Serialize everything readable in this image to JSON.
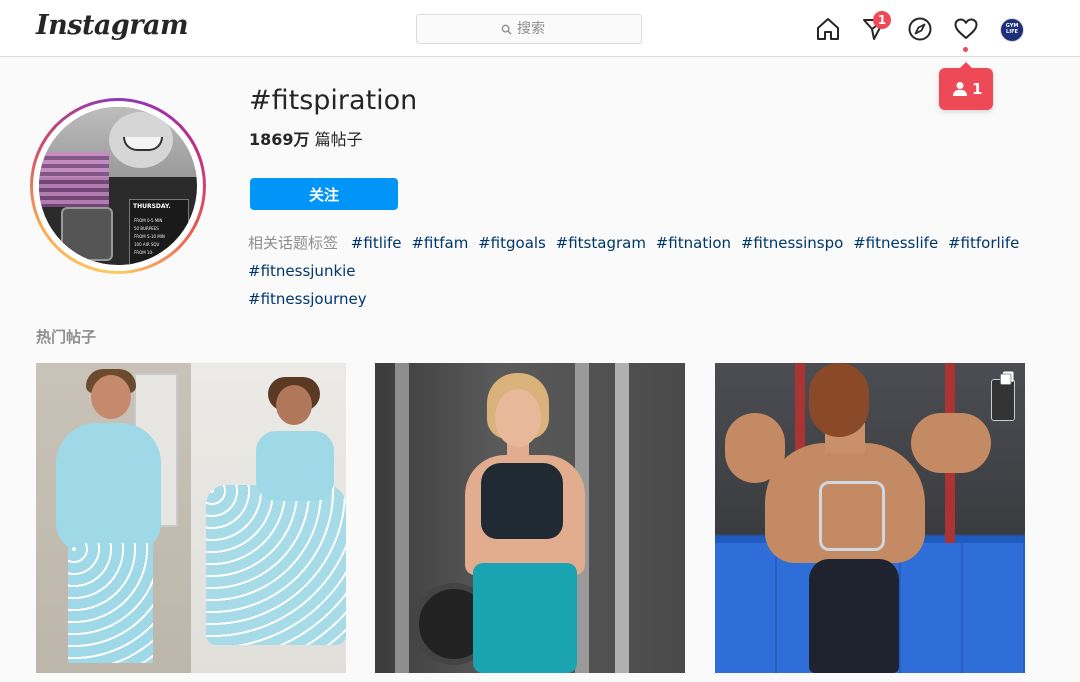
{
  "nav": {
    "logo": "Instagram",
    "search_placeholder": "搜索",
    "direct_badge": "1",
    "avatar_text": "GYM LIFE"
  },
  "notification_tip": {
    "count": "1"
  },
  "header": {
    "hashtag": "#fitspiration",
    "post_count_number": "1869万",
    "post_count_suffix": " 篇帖子",
    "follow_label": "关注",
    "related_label": "相关话题标签",
    "related_tags": [
      "#fitlife",
      "#fitfam",
      "#fitgoals",
      "#fitstagram",
      "#fitnation",
      "#fitnessinspo",
      "#fitnesslife",
      "#fitforlife",
      "#fitnessjunkie",
      "#fitnessjourney"
    ]
  },
  "profile_pic_text": {
    "card_title": "THURSDAY.",
    "card_lines": [
      "FROM 0-5 MIN",
      "50 BURPEES",
      "FROM 5-10 MIN",
      "100 AIR SQU",
      "FROM 10-"
    ]
  },
  "top_posts": {
    "title": "热门帖子"
  },
  "colors": {
    "accent": "#0095f6",
    "notification": "#ed4956",
    "link": "#00376b"
  },
  "icons": [
    "home-icon",
    "direct-icon",
    "explore-icon",
    "heart-icon",
    "search-icon",
    "person-icon",
    "multi-post-icon"
  ]
}
